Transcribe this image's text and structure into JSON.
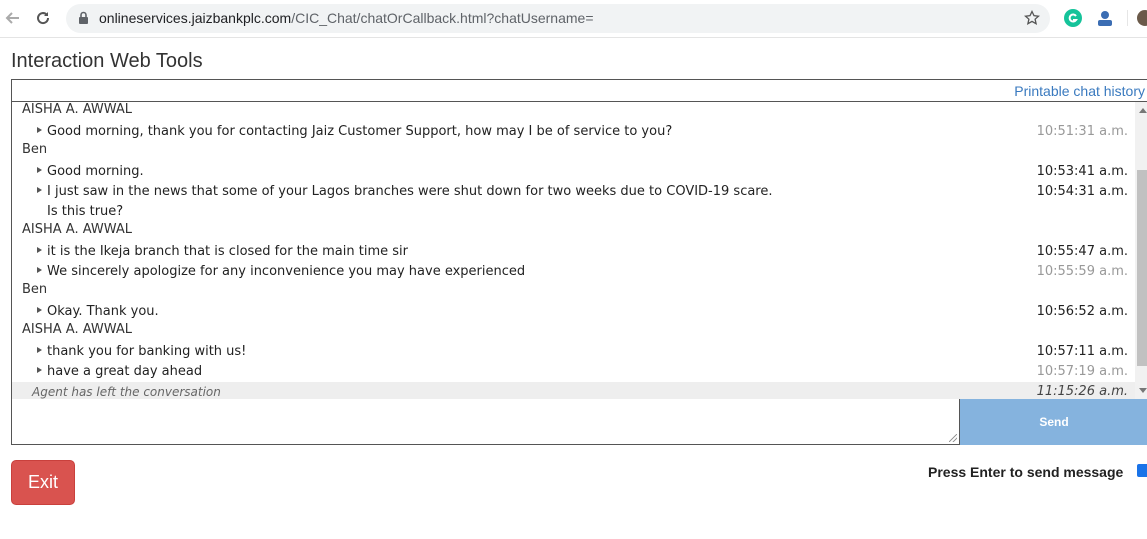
{
  "browser": {
    "url_host": "onlineservices.jaizbankplc.com",
    "url_path": "/CIC_Chat/chatOrCallback.html?chatUsername="
  },
  "page": {
    "title": "Interaction Web Tools",
    "print_link": "Printable chat history"
  },
  "transcript": {
    "rows": [
      {
        "type": "sender",
        "name": "AISHA A. AWWAL"
      },
      {
        "type": "msg",
        "text": "Good morning, thank you for contacting Jaiz Customer Support, how may I be of service to you?",
        "time": "10:51:31 a.m."
      },
      {
        "type": "sender",
        "name": "Ben"
      },
      {
        "type": "msg",
        "text": "Good morning.",
        "time": "10:53:41 a.m."
      },
      {
        "type": "msg",
        "text": "I just saw in the news that some of your Lagos branches were shut down for two weeks due to COVID-19 scare.",
        "time": "10:54:31 a.m."
      },
      {
        "type": "cont",
        "text": "Is this true?"
      },
      {
        "type": "sender",
        "name": "AISHA A. AWWAL"
      },
      {
        "type": "msg",
        "text": "it is the Ikeja branch that is closed for the main time sir",
        "time": "10:55:47 a.m."
      },
      {
        "type": "msg",
        "text": "We sincerely apologize for any inconvenience you may have experienced",
        "time": "10:55:59 a.m."
      },
      {
        "type": "sender",
        "name": "Ben"
      },
      {
        "type": "msg",
        "text": "Okay. Thank you.",
        "time": "10:56:52 a.m."
      },
      {
        "type": "sender",
        "name": "AISHA A. AWWAL"
      },
      {
        "type": "msg",
        "text": "thank you for banking with us!",
        "time": "10:57:11 a.m."
      },
      {
        "type": "msg",
        "text": "have a great day ahead",
        "time": "10:57:19 a.m."
      },
      {
        "type": "system",
        "text": "Agent has left the conversation",
        "time": "11:15:26 a.m."
      }
    ]
  },
  "composer": {
    "send_label": "Send",
    "message_value": ""
  },
  "footer": {
    "exit_label": "Exit",
    "enter_label": "Press Enter to send message",
    "enter_checked": true
  },
  "colors": {
    "link": "#3a7abf",
    "send_button": "#85b3de",
    "exit_button": "#d9534f"
  }
}
